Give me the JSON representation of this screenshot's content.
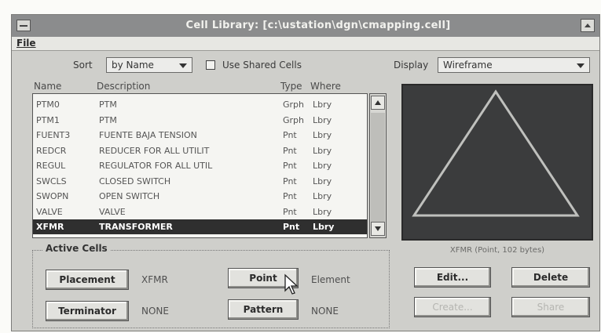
{
  "window": {
    "title": "Cell Library: [c:\\ustation\\dgn\\cmapping.cell]"
  },
  "menu": {
    "file": "File"
  },
  "sort": {
    "label": "Sort",
    "value": "by Name"
  },
  "use_shared_cells": {
    "label": "Use Shared Cells",
    "checked": false
  },
  "display": {
    "label": "Display",
    "value": "Wireframe"
  },
  "columns": {
    "name": "Name",
    "description": "Description",
    "type": "Type",
    "where": "Where"
  },
  "cells": [
    {
      "name": "PTM0",
      "description": "PTM",
      "type": "Grph",
      "where": "Lbry"
    },
    {
      "name": "PTM1",
      "description": "PTM",
      "type": "Grph",
      "where": "Lbry"
    },
    {
      "name": "FUENT3",
      "description": "FUENTE BAJA TENSION",
      "type": "Pnt",
      "where": "Lbry"
    },
    {
      "name": "REDCR",
      "description": "REDUCER FOR ALL UTILIT",
      "type": "Pnt",
      "where": "Lbry"
    },
    {
      "name": "REGUL",
      "description": "REGULATOR FOR ALL UTIL",
      "type": "Pnt",
      "where": "Lbry"
    },
    {
      "name": "SWCLS",
      "description": "CLOSED SWITCH",
      "type": "Pnt",
      "where": "Lbry"
    },
    {
      "name": "SWOPN",
      "description": "OPEN SWITCH",
      "type": "Pnt",
      "where": "Lbry"
    },
    {
      "name": "VALVE",
      "description": "VALVE",
      "type": "Pnt",
      "where": "Lbry"
    },
    {
      "name": "XFMR",
      "description": "TRANSFORMER",
      "type": "Pnt",
      "where": "Lbry"
    }
  ],
  "selected_index": 8,
  "preview": {
    "caption": "XFMR (Point, 102 bytes)"
  },
  "active_cells": {
    "title": "Active Cells",
    "placement_button": "Placement",
    "placement_value": "XFMR",
    "point_button": "Point",
    "point_value": "Element",
    "terminator_button": "Terminator",
    "terminator_value": "NONE",
    "pattern_button": "Pattern",
    "pattern_value": "NONE"
  },
  "buttons": {
    "edit": "Edit...",
    "delete": "Delete",
    "create": "Create...",
    "share": "Share"
  },
  "colors": {
    "titlebar": "#8b8c8d",
    "dialog": "#cfcfcb",
    "preview_bg": "#3b3c3d",
    "selection": "#2f2f2f"
  }
}
